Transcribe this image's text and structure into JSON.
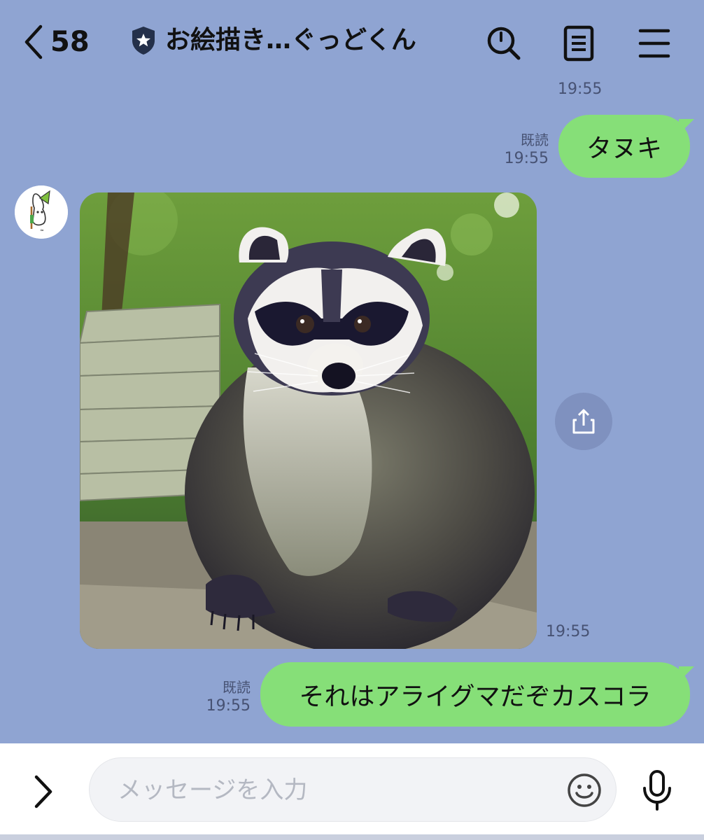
{
  "header": {
    "back_count": "58",
    "title": "お絵描き…ぐっどくん",
    "icons": [
      "chevron-left-icon",
      "shield-star-icon",
      "search-icon",
      "note-icon",
      "menu-icon"
    ]
  },
  "messages": [
    {
      "type": "timestamp",
      "time": "19:55"
    },
    {
      "type": "outgoing",
      "read_label": "既読",
      "time": "19:55",
      "text": "タヌキ"
    },
    {
      "type": "incoming-image",
      "time": "19:55",
      "image": "raccoon-photo",
      "action_icon": "share-icon"
    },
    {
      "type": "outgoing",
      "read_label": "既読",
      "time": "19:55",
      "text": "それはアライグマだぞカスコラ"
    }
  ],
  "input": {
    "placeholder": "メッセージを入力",
    "icons": [
      "chevron-right-icon",
      "emoji-icon",
      "mic-icon"
    ]
  },
  "colors": {
    "background": "#8fa4d2",
    "bubble": "#86df78",
    "timestamp": "#475273",
    "footer": "#ffffff"
  }
}
